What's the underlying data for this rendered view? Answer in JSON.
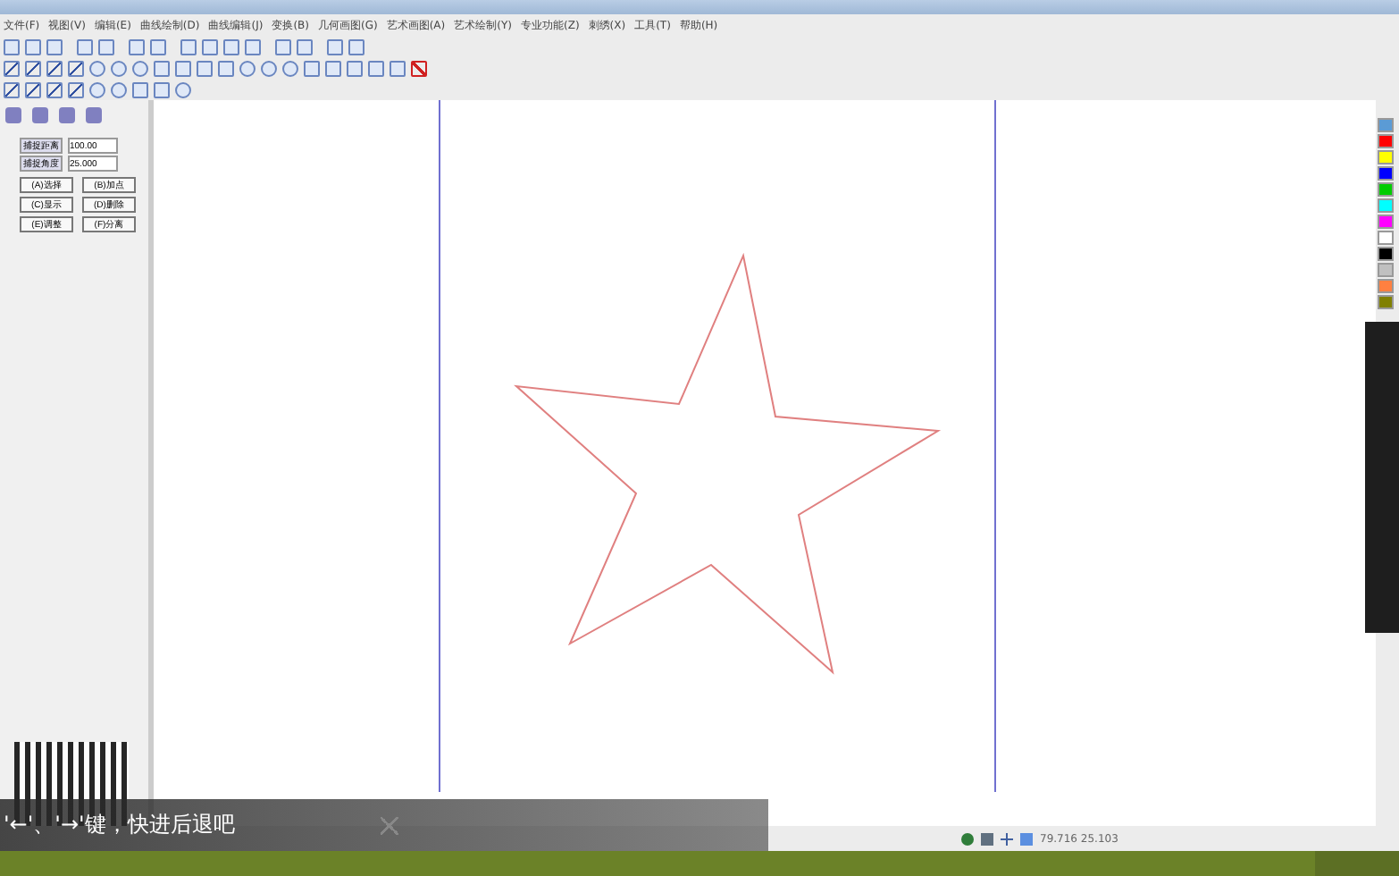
{
  "menu": [
    "文件(F)",
    "视图(V)",
    "编辑(E)",
    "曲线绘制(D)",
    "曲线编辑(J)",
    "变换(B)",
    "几何画图(G)",
    "艺术画图(A)",
    "艺术绘制(Y)",
    "专业功能(Z)",
    "刺绣(X)",
    "工具(T)",
    "帮助(H)"
  ],
  "panel": {
    "fields": [
      {
        "label": "捕捉距离",
        "value": "100.00"
      },
      {
        "label": "捕捉角度",
        "value": "25.000"
      }
    ],
    "buttons": [
      "(A)选择",
      "(B)加点",
      "(C)显示",
      "(D)删除",
      "(E)调整",
      "(F)分离"
    ]
  },
  "palette": [
    {
      "color": "#5b9bd5"
    },
    {
      "color": "#ff0000"
    },
    {
      "color": "#ffff00"
    },
    {
      "color": "#0000ff"
    },
    {
      "color": "#00cc00"
    },
    {
      "color": "#00ffff"
    },
    {
      "color": "#ff00ff"
    },
    {
      "color": "#ffffff"
    },
    {
      "color": "#000000"
    },
    {
      "color": "#c0c0c0"
    },
    {
      "color": "#ff8040"
    },
    {
      "color": "#808000"
    }
  ],
  "status": {
    "coordinates": "79.716  25.103"
  },
  "player": {
    "hint": "'←'、'→'键，快进后退吧",
    "level": 0.94
  }
}
